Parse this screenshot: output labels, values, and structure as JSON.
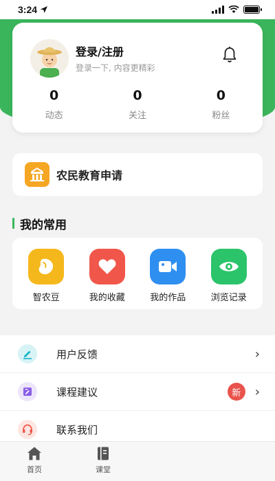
{
  "status_bar": {
    "time": "3:24",
    "icons": [
      "location-arrow-icon",
      "signal-icon",
      "wifi-icon",
      "battery-icon"
    ]
  },
  "profile": {
    "title": "登录/注册",
    "subtitle": "登录一下, 内容更精彩",
    "avatar_icon": "farmer-avatar-icon",
    "notification_icon": "bell-icon",
    "stats": [
      {
        "value": "0",
        "label": "动态"
      },
      {
        "value": "0",
        "label": "关注"
      },
      {
        "value": "0",
        "label": "粉丝"
      }
    ]
  },
  "education": {
    "label": "农民教育申请",
    "icon": "school-building-icon"
  },
  "common": {
    "title": "我的常用",
    "items": [
      {
        "label": "智农豆",
        "icon": "bean-icon",
        "color": "#f5b81c"
      },
      {
        "label": "我的收藏",
        "icon": "heart-icon",
        "color": "#f0574a"
      },
      {
        "label": "我的作品",
        "icon": "video-camera-icon",
        "color": "#2f8ff0"
      },
      {
        "label": "浏览记录",
        "icon": "eye-icon",
        "color": "#2bc46a"
      }
    ]
  },
  "menu": [
    {
      "label": "用户反馈",
      "icon": "pencil-icon",
      "icon_bg": "#d8f3f6",
      "icon_color": "#17b6c9",
      "badge": "",
      "chevron": "›"
    },
    {
      "label": "课程建议",
      "icon": "edit-note-icon",
      "icon_bg": "#ece5fb",
      "icon_color": "#8a5ce6",
      "badge": "新",
      "chevron": "›"
    },
    {
      "label": "联系我们",
      "icon": "headset-icon",
      "icon_bg": "#fde6e2",
      "icon_color": "#f0574a",
      "badge": "",
      "chevron": ""
    }
  ],
  "tabs": [
    {
      "label": "首页",
      "icon": "home-icon"
    },
    {
      "label": "课堂",
      "icon": "book-icon"
    }
  ],
  "colors": {
    "brand_green": "#3bb55b",
    "badge_red": "#e9534c"
  }
}
